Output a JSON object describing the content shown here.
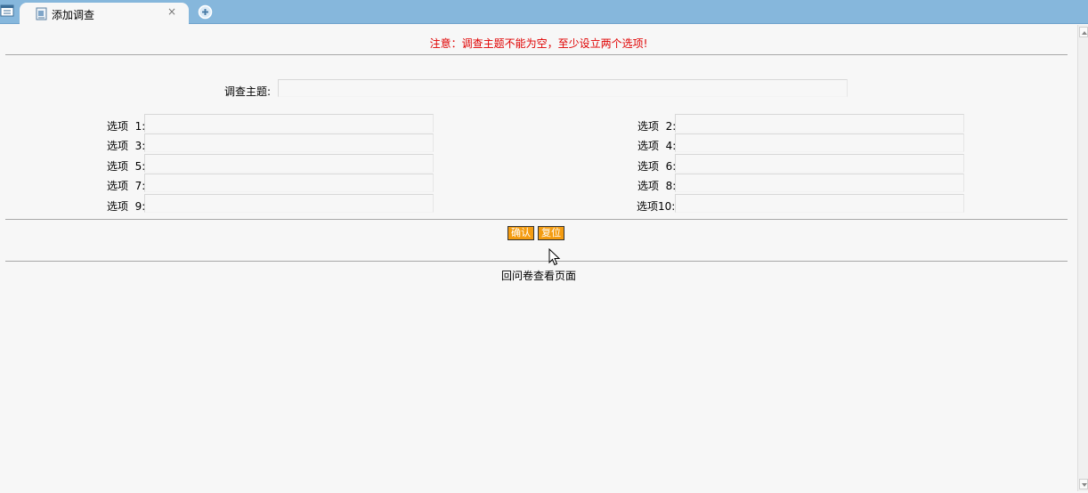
{
  "tabbar": {
    "tab_title": "添加调查",
    "close_glyph": "×",
    "menu_icon": "window-list-icon",
    "tab_icon": "document-icon",
    "add_icon": "add-tab-icon"
  },
  "notice": "注意：调查主题不能为空，至少设立两个选项!",
  "form": {
    "subject_label": "调查主题:",
    "subject_value": "",
    "options": [
      {
        "label": "选项  1:",
        "value": ""
      },
      {
        "label": "选项  2:",
        "value": ""
      },
      {
        "label": "选项  3:",
        "value": ""
      },
      {
        "label": "选项  4:",
        "value": ""
      },
      {
        "label": "选项  5:",
        "value": ""
      },
      {
        "label": "选项  6:",
        "value": ""
      },
      {
        "label": "选项  7:",
        "value": ""
      },
      {
        "label": "选项  8:",
        "value": ""
      },
      {
        "label": "选项  9:",
        "value": ""
      },
      {
        "label": "选项10:",
        "value": ""
      }
    ]
  },
  "buttons": {
    "confirm": "确认",
    "reset": "复位"
  },
  "back_link": "回问卷查看页面",
  "colors": {
    "tabbar": "#86b7dc",
    "notice": "#e00000",
    "button": "#f49c11"
  }
}
